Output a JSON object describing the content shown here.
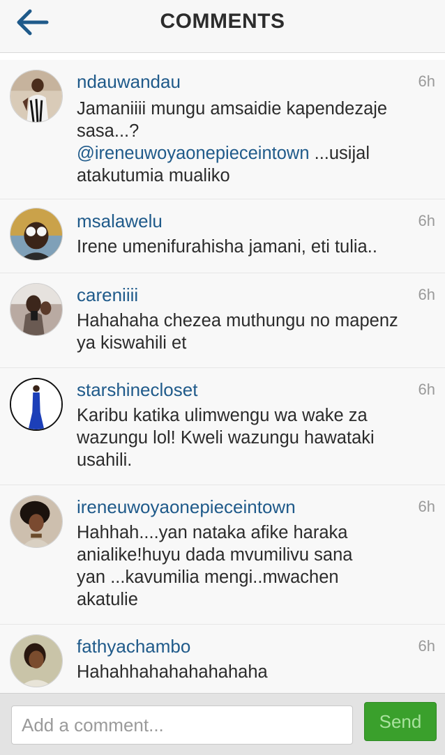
{
  "header": {
    "title": "COMMENTS",
    "back_icon": "back-arrow-icon"
  },
  "colors": {
    "username": "#1f5a8a",
    "back_arrow": "#1f5a8a",
    "send_button": "#3aa02c",
    "send_text": "#a9e29e"
  },
  "comments": [
    {
      "username": "ndauwandau",
      "time": "6h",
      "text_lines": [
        "Jamaniiii mungu amsaidie kapendezaje",
        "sasa...?"
      ],
      "mention": "@ireneuwoyaonepieceintown",
      "mention_suffix": " ...usijal",
      "text_tail": "atakutumia mualiko"
    },
    {
      "username": "msalawelu",
      "time": "6h",
      "text_lines": [
        "Irene umenifurahisha jamani, eti tulia.."
      ]
    },
    {
      "username": "careniiii",
      "time": "6h",
      "text_lines": [
        "Hahahaha chezea muthungu no mapenz",
        "ya kiswahili et"
      ]
    },
    {
      "username": "starshinecloset",
      "time": "6h",
      "text_lines": [
        "Karibu katika ulimwengu wa wake za",
        "wazungu lol! Kweli wazungu hawataki",
        "usahili."
      ]
    },
    {
      "username": "ireneuwoyaonepieceintown",
      "time": "6h",
      "text_lines": [
        "Hahhah....yan nataka afike haraka",
        "anialike!huyu dada mvumilivu sana",
        "yan ...kavumilia mengi..mwachen",
        "akatulie"
      ]
    },
    {
      "username": "fathyachambo",
      "time": "6h",
      "text_lines": [
        "Hahahhahahahahahaha"
      ]
    }
  ],
  "footer": {
    "input_placeholder": "Add a comment...",
    "send_label": "Send"
  }
}
